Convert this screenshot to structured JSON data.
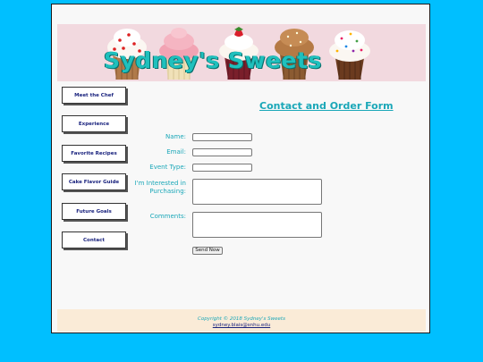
{
  "header": {
    "title": "Sydney's Sweets"
  },
  "nav": [
    {
      "label": "Meet the Chef"
    },
    {
      "label": "Experience"
    },
    {
      "label": "Favorite Recipes"
    },
    {
      "label": "Cake Flavor Guide"
    },
    {
      "label": "Future Goals"
    },
    {
      "label": "Contact"
    }
  ],
  "form": {
    "title": "Contact and Order Form",
    "name_label": "Name:",
    "email_label": "Email:",
    "event_label": "Event Type:",
    "interest_label": "I'm Interested in Purchasing:",
    "comments_label": "Comments:",
    "send_label": "Send Now"
  },
  "footer": {
    "copyright": "Copyright © 2018 Sydney's Sweets",
    "email": "sydney.blais@snhu.edu"
  },
  "colors": {
    "background": "#00bfff",
    "banner": "#f2d9df",
    "title": "#1fc0bd",
    "label": "#1aa7b8",
    "footer": "#faebd7"
  }
}
